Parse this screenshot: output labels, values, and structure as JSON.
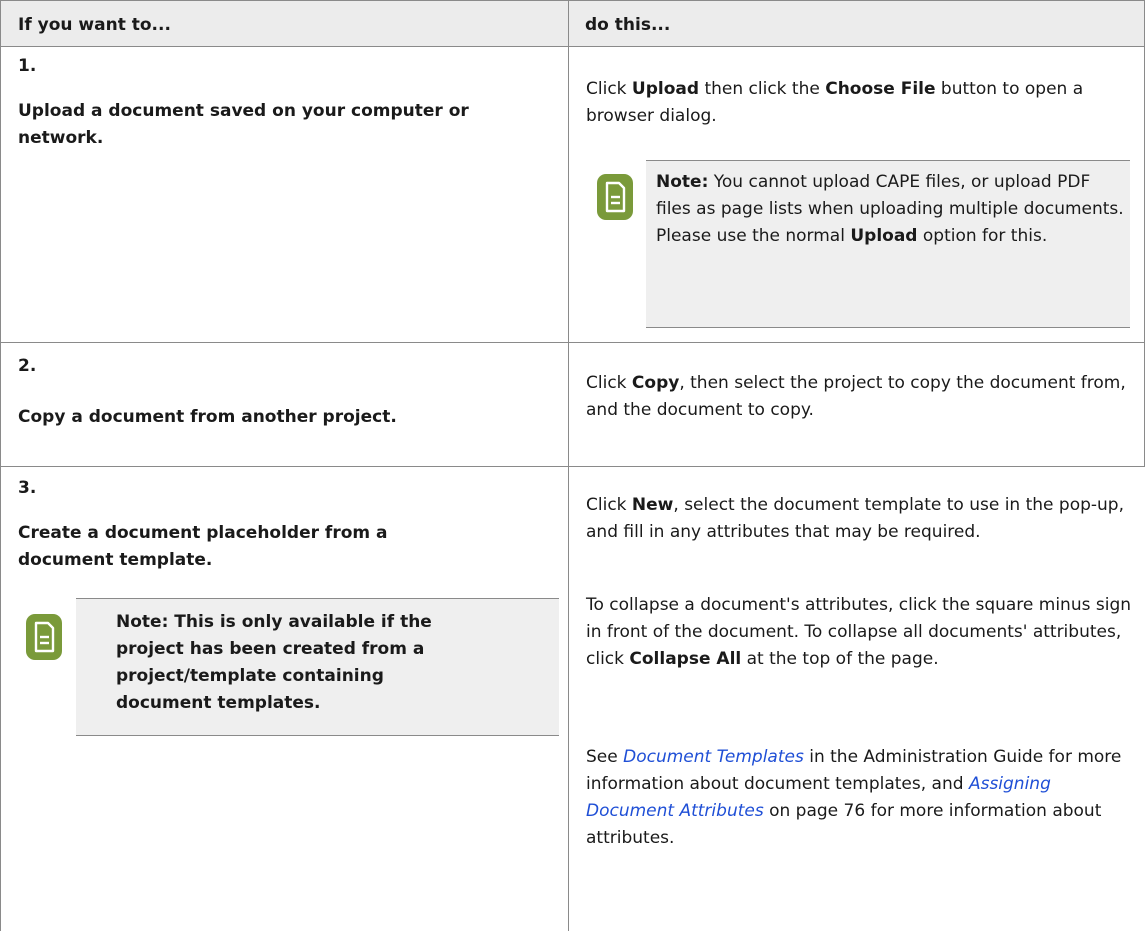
{
  "table": {
    "header": {
      "col1": "If you want to...",
      "col2": "do this..."
    },
    "row1": {
      "number": "1.",
      "task": "Upload a document saved on your computer or network.",
      "action": {
        "p1_a": "Click ",
        "p1_b": "Upload",
        "p1_c": " then click the ",
        "p1_d": "Choose File",
        "p1_e": " button to open a browser dialog."
      },
      "note": {
        "label": "Note:",
        "text_a": " You cannot upload CAPE files, or upload PDF files as page lists when uploading multiple documents. Please use the normal ",
        "text_b": "Upload",
        "text_c": "  option for this."
      }
    },
    "row2": {
      "number": "2.",
      "task": "Copy a document from another project.",
      "action": {
        "a": "Click ",
        "b": "Copy",
        "c": ", then select the project to copy the document from, and the document to copy."
      }
    },
    "row3": {
      "number": "3.",
      "task": "Create a document placeholder from a document template.",
      "note": {
        "label": "Note:",
        "text": "  This is only available if the project has been created from a project/template containing document templates."
      },
      "p1": {
        "a": "Click ",
        "b": "New",
        "c": ", select the document template to use in the pop-up, and fill in any attributes that may be required."
      },
      "p2": {
        "a": "To collapse a document's attributes, click the square minus sign in front of the document. To collapse all documents' attributes, click ",
        "b": "Collapse All",
        "c": " at the top of the page."
      },
      "p3": {
        "a": "See ",
        "link1": "Document Templates",
        "b": " in the Administration Guide for more information about document templates, and ",
        "link2": "Assigning Document Attributes",
        "c": " on page 76 for more information about attributes."
      }
    }
  },
  "icons": {
    "note_icon": "document-note-icon",
    "note_color": "#7a9a3a"
  }
}
